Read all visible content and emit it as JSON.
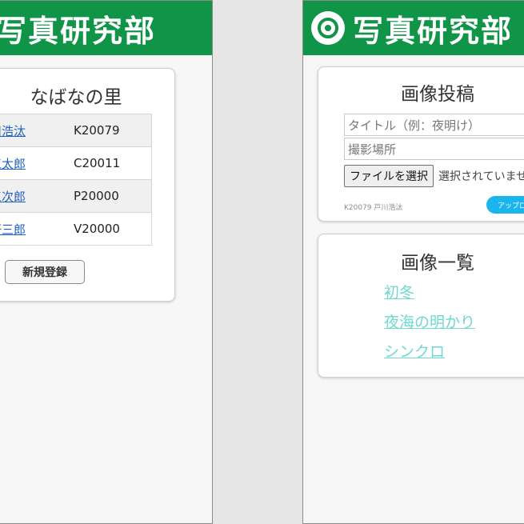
{
  "app": {
    "title": "写真研究部"
  },
  "left_screen": {
    "heading": "なばなの里",
    "members": [
      {
        "name": "戸川浩汰",
        "code": "K20079"
      },
      {
        "name": "夢工太郎",
        "code": "C20011"
      },
      {
        "name": "夢工次郎",
        "code": "P20000"
      },
      {
        "name": "夢研三郎",
        "code": "V20000"
      }
    ],
    "register_button": "新規登録"
  },
  "right_screen": {
    "upload": {
      "heading": "画像投稿",
      "title_placeholder": "タイトル（例：夜明け）",
      "place_placeholder": "撮影場所",
      "file_button": "ファイルを選択",
      "file_status": "選択されていません",
      "user_line": "K20079 戸川浩汰",
      "upload_button": "アップロード"
    },
    "list": {
      "heading": "画像一覧",
      "items": [
        "初冬",
        "夜海の明かり",
        "シンクロ"
      ]
    }
  },
  "colors": {
    "header_green": "#109447",
    "link_blue": "#1f5fbf",
    "link_teal": "#6fd9d0",
    "button_cyan": "#1ab5ef"
  },
  "icons": {
    "logo": "camera-aperture-icon"
  }
}
